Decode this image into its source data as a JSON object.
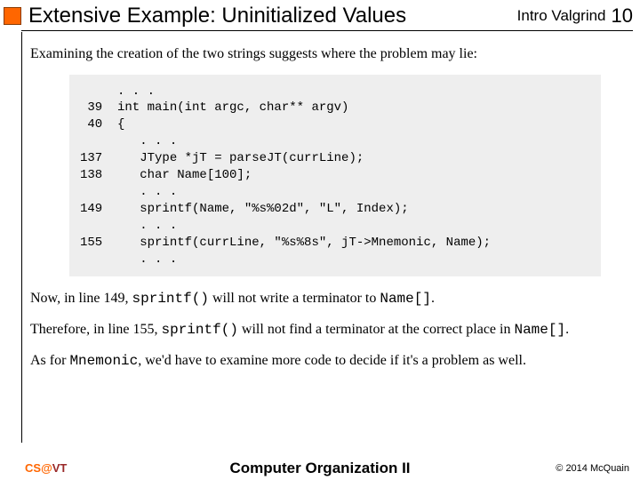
{
  "header": {
    "title": "Extensive Example:  Uninitialized Values",
    "course": "Intro Valgrind",
    "page": "10"
  },
  "content": {
    "intro": "Examining the creation of the two strings suggests where the problem may lie:",
    "code_text": "     . . .\n 39  int main(int argc, char** argv)\n 40  {\n        . . .\n137     JType *jT = parseJT(currLine);\n138     char Name[100];\n        . . .\n149     sprintf(Name, \"%s%02d\", \"L\", Index);\n        . . .\n155     sprintf(currLine, \"%s%8s\", jT->Mnemonic, Name);\n        . . .",
    "p1a": "Now, in line 149, ",
    "p1b": "sprintf()",
    "p1c": " will not write a terminator to ",
    "p1d": "Name[]",
    "p1e": ".",
    "p2a": "Therefore, in line 155, ",
    "p2b": "sprintf()",
    "p2c": " will not find a terminator at the correct place in ",
    "p2d": "Name[]",
    "p2e": ".",
    "p3a": "As for ",
    "p3b": "Mnemonic",
    "p3c": ", we'd have to examine more code to decide if it's a problem as well."
  },
  "footer": {
    "left_cs": "CS",
    "left_at": "@",
    "left_vt": "VT",
    "center": "Computer Organization II",
    "right": "© 2014 McQuain"
  }
}
